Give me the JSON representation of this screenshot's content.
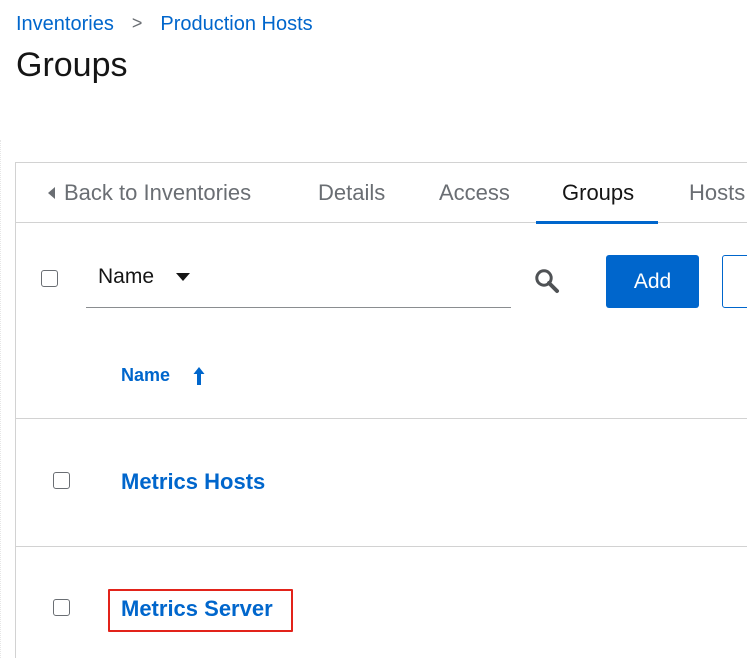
{
  "breadcrumb": {
    "items": [
      "Inventories",
      "Production Hosts"
    ],
    "separator": ">"
  },
  "page": {
    "title": "Groups"
  },
  "tabs": {
    "back_label": "Back to Inventories",
    "items": [
      "Details",
      "Access",
      "Groups",
      "Hosts"
    ],
    "active": "Groups"
  },
  "toolbar": {
    "filter_select_value": "Name",
    "search_placeholder": "",
    "add_label": "Add"
  },
  "table": {
    "columns": [
      {
        "label": "Name",
        "sort": "ascending"
      }
    ],
    "rows": [
      {
        "name": "Metrics Hosts",
        "highlighted": false
      },
      {
        "name": "Metrics Server",
        "highlighted": true
      }
    ]
  },
  "colors": {
    "link_blue": "#0066cc",
    "primary_button": "#0066cc",
    "highlight_red": "#e2231a",
    "border_gray": "#d2d2d2"
  },
  "icons": {
    "back": "caret-left-icon",
    "filter_dropdown": "caret-down-icon",
    "search": "search-icon",
    "sort": "sort-ascending-icon"
  }
}
